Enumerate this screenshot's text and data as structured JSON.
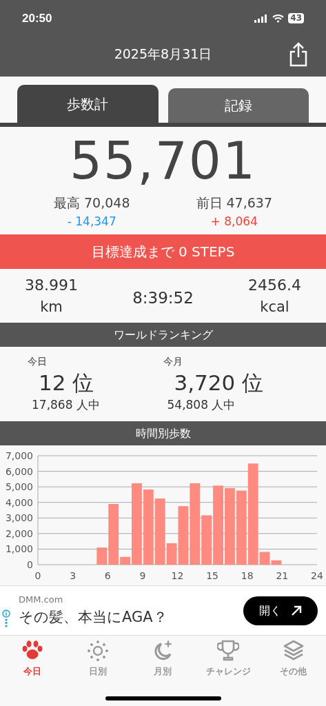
{
  "status_bar": {
    "time": "20:50",
    "battery": "43"
  },
  "header": {
    "title": "2025年8月31日"
  },
  "tabs": [
    {
      "label": "歩数計",
      "selected": true
    },
    {
      "label": "記録",
      "selected": false
    }
  ],
  "steps": "55,701",
  "best": {
    "label": "最高",
    "value": "70,048",
    "diff": "- 14,347"
  },
  "previous": {
    "label": "前日",
    "value": "47,637",
    "diff": "+ 8,064"
  },
  "goal_banner": "目標達成まで 0 STEPS",
  "distance": {
    "value": "38.991",
    "unit": "km"
  },
  "duration": "8:39:52",
  "calories": {
    "value": "2456.4",
    "unit": "kcal"
  },
  "ranking": {
    "title": "ワールドランキング",
    "items": [
      {
        "period": "今日",
        "rank": "12 位",
        "total": "17,868 人中"
      },
      {
        "period": "今月",
        "rank": "3,720 位",
        "total": "54,808 人中"
      }
    ]
  },
  "hourly": {
    "title": "時間別歩数",
    "chart_data": {
      "type": "bar",
      "x": [
        0.5,
        1.5,
        2.5,
        3.5,
        4.5,
        5.5,
        6.5,
        7.5,
        8.5,
        9.5,
        10.5,
        11.5,
        12.5,
        13.5,
        14.5,
        15.5,
        16.5,
        17.5,
        18.5,
        19.5,
        20.5,
        21.5,
        22.5,
        23.5
      ],
      "grid": true,
      "series": [
        {
          "color": "#ff8a80",
          "values": [
            0,
            0,
            0,
            0,
            0,
            1100,
            3900,
            500,
            5230,
            4830,
            4250,
            1380,
            3760,
            5230,
            3170,
            5080,
            4920,
            4760,
            6500,
            820,
            280,
            0,
            0,
            0
          ]
        }
      ],
      "xlim": [
        0,
        24
      ],
      "ylim": [
        0,
        7000
      ],
      "xticks": [
        0,
        3,
        6,
        9,
        12,
        15,
        18,
        21,
        24
      ],
      "yticks": [
        {
          "value": 0,
          "label": "0"
        },
        {
          "value": 1000,
          "label": "1,000"
        },
        {
          "value": 2000,
          "label": "2,000"
        },
        {
          "value": 3000,
          "label": "3,000"
        },
        {
          "value": 4000,
          "label": "4,000"
        },
        {
          "value": 5000,
          "label": "5,000"
        },
        {
          "value": 6000,
          "label": "6,000"
        },
        {
          "value": 7000,
          "label": "7,000"
        }
      ]
    }
  },
  "ad": {
    "advertiser": "DMM.com",
    "headline": "その髪、本当にAGA？",
    "button": "開く"
  },
  "nav": [
    {
      "kind": "paw",
      "label": "今日",
      "selected": true
    },
    {
      "kind": "sun",
      "label": "日別",
      "selected": false
    },
    {
      "kind": "moon",
      "label": "月別",
      "selected": false
    },
    {
      "kind": "trophy",
      "label": "チャレンジ",
      "selected": false
    },
    {
      "kind": "layers",
      "label": "その他",
      "selected": false
    }
  ]
}
